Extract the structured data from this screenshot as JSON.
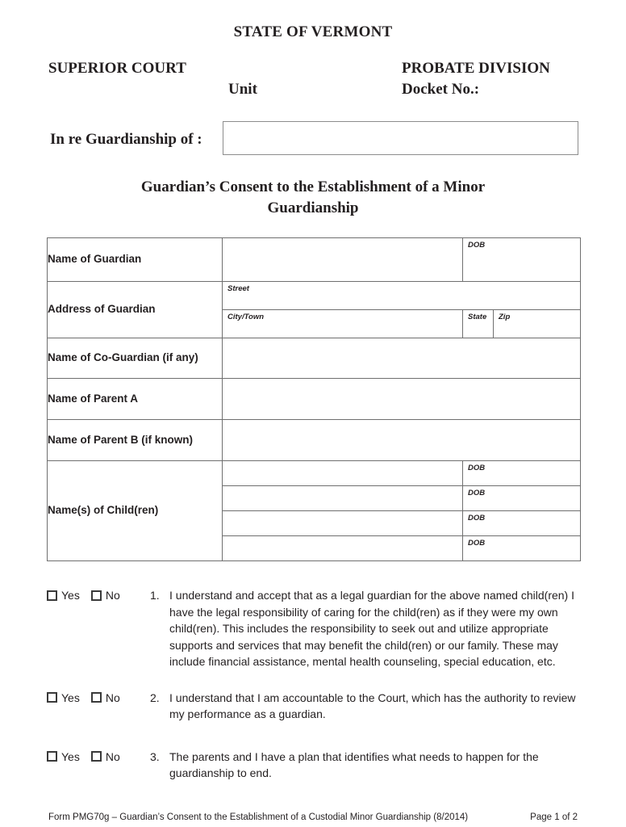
{
  "header": {
    "state_title": "STATE OF VERMONT",
    "superior_court": "SUPERIOR COURT",
    "probate_division": "PROBATE DIVISION",
    "unit_label": "Unit",
    "docket_label": "Docket No.:"
  },
  "case_caption": {
    "in_re_label": "In re Guardianship of :",
    "in_re_value": "",
    "in_re_placeholder": ""
  },
  "doc_title": "Guardian’s Consent to the Establishment of a Minor Guardianship",
  "table": {
    "micro_labels": {
      "dob": "DOB",
      "street": "Street",
      "city_town": "City/Town",
      "state": "State",
      "zip": "Zip"
    },
    "rows": {
      "name_of_guardian": "Name of Guardian",
      "address_of_guardian": "Address of Guardian",
      "name_of_co_guardian": "Name of Co-Guardian (if any)",
      "name_of_parent_a": "Name of Parent A",
      "name_of_parent_b": "Name of Parent B (if known)",
      "names_of_children": "Name(s) of Child(ren)"
    },
    "values": {
      "guardian_name": "",
      "guardian_dob": "",
      "guardian_street": "",
      "guardian_city_town": "",
      "guardian_state": "",
      "guardian_zip": "",
      "co_guardian_name": "",
      "parent_a_name": "",
      "parent_b_name": "",
      "child_1_name": "",
      "child_1_dob": "",
      "child_2_name": "",
      "child_2_dob": "",
      "child_3_name": "",
      "child_3_dob": "",
      "child_4_name": "",
      "child_4_dob": ""
    }
  },
  "consent_items": {
    "yes_label": "Yes",
    "no_label": "No",
    "items": [
      {
        "number": "1.",
        "text": "I understand and accept that as a legal guardian for the above named child(ren) I have the legal responsibility of caring for the child(ren) as if they were my own child(ren).  This includes the responsibility to seek out and utilize appropriate supports and services that may benefit the child(ren) or our family.  These may include financial assistance, mental health counseling, special education, etc.",
        "yes_checked": false,
        "no_checked": false
      },
      {
        "number": "2.",
        "text": "I understand that I am accountable to the Court, which has the authority to review my performance as a guardian.",
        "yes_checked": false,
        "no_checked": false
      },
      {
        "number": "3.",
        "text": "The parents and I have a plan that identifies what needs to happen for the guardianship to end.",
        "yes_checked": false,
        "no_checked": false
      }
    ]
  },
  "footer": {
    "form_line": "Form PMG70g – Guardian’s Consent to the Establishment of a Custodial Minor Guardianship (8/2014)",
    "page_number": "Page 1 of 2"
  }
}
